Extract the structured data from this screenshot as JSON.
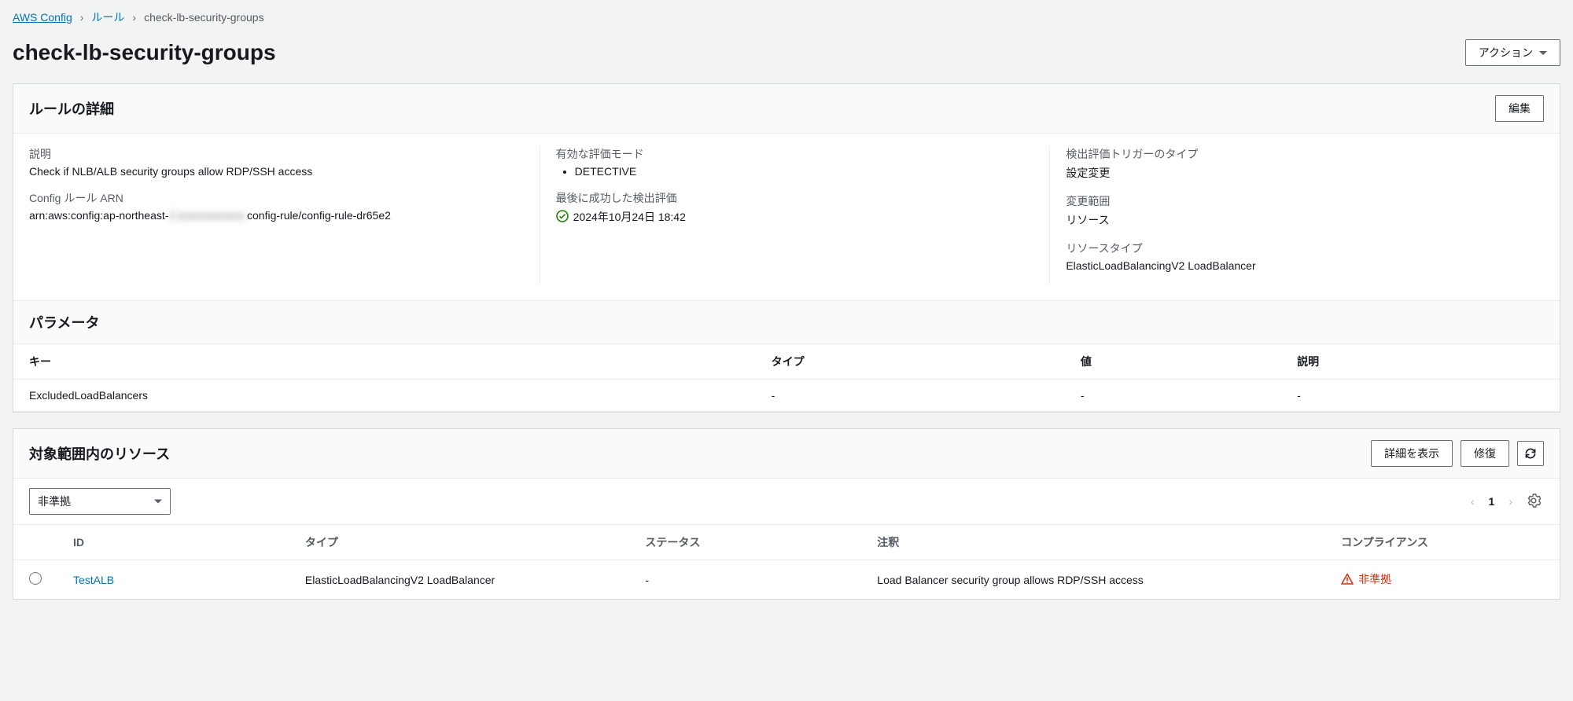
{
  "breadcrumb": {
    "root": "AWS Config",
    "rules": "ルール",
    "current": "check-lb-security-groups"
  },
  "page": {
    "title": "check-lb-security-groups",
    "actions_label": "アクション"
  },
  "details": {
    "title": "ルールの詳細",
    "edit_label": "編集",
    "desc_label": "説明",
    "desc_value": "Check if NLB/ALB security groups allow RDP/SSH access",
    "arn_label": "Config ルール ARN",
    "arn_prefix": "arn:aws:config:ap-northeast-",
    "arn_masked": "1:xxxxxxxxxxxx:",
    "arn_suffix": "config-rule/config-rule-dr65e2",
    "eval_mode_label": "有効な評価モード",
    "eval_mode_value": "DETECTIVE",
    "last_success_label": "最後に成功した検出評価",
    "last_success_value": "2024年10月24日 18:42",
    "trigger_label": "検出評価トリガーのタイプ",
    "trigger_value": "設定変更",
    "scope_label": "変更範囲",
    "scope_value": "リソース",
    "restype_label": "リソースタイプ",
    "restype_value": "ElasticLoadBalancingV2 LoadBalancer"
  },
  "params": {
    "title": "パラメータ",
    "headers": {
      "key": "キー",
      "type": "タイプ",
      "value": "値",
      "desc": "説明"
    },
    "rows": [
      {
        "key": "ExcludedLoadBalancers",
        "type": "-",
        "value": "-",
        "desc": "-"
      }
    ]
  },
  "resources": {
    "title": "対象範囲内のリソース",
    "show_details_label": "詳細を表示",
    "remediate_label": "修復",
    "filter_value": "非準拠",
    "page_num": "1",
    "headers": {
      "id": "ID",
      "type": "タイプ",
      "status": "ステータス",
      "annotation": "注釈",
      "compliance": "コンプライアンス"
    },
    "rows": [
      {
        "id": "TestALB",
        "type": "ElasticLoadBalancingV2 LoadBalancer",
        "status": "-",
        "annotation": "Load Balancer security group allows RDP/SSH access",
        "compliance": "非準拠"
      }
    ]
  }
}
